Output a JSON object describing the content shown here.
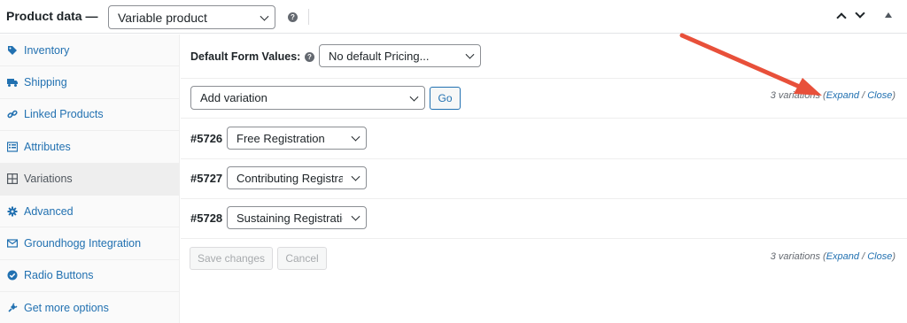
{
  "header": {
    "title": "Product data —",
    "product_type": "Variable product"
  },
  "sidebar": {
    "items": [
      {
        "label": "Inventory",
        "icon": "tag-icon"
      },
      {
        "label": "Shipping",
        "icon": "truck-icon"
      },
      {
        "label": "Linked Products",
        "icon": "link-icon"
      },
      {
        "label": "Attributes",
        "icon": "list-icon"
      },
      {
        "label": "Variations",
        "icon": "grid-icon"
      },
      {
        "label": "Advanced",
        "icon": "gear-icon"
      },
      {
        "label": "Groundhogg Integration",
        "icon": "email-icon"
      },
      {
        "label": "Radio Buttons",
        "icon": "check-circle-icon"
      },
      {
        "label": "Get more options",
        "icon": "plugin-icon"
      }
    ],
    "active_index": 4
  },
  "defaults": {
    "label": "Default Form Values:",
    "value": "No default Pricing..."
  },
  "toolbar": {
    "action": "Add variation",
    "go_label": "Go"
  },
  "meta": {
    "count": "3 variations (",
    "expand": "Expand",
    "sep": " / ",
    "close": "Close",
    "end": ")"
  },
  "variations": [
    {
      "id": "#5726",
      "value": "Free Registration"
    },
    {
      "id": "#5727",
      "value": "Contributing Registration"
    },
    {
      "id": "#5728",
      "value": "Sustaining Registration"
    }
  ],
  "footer": {
    "save_label": "Save changes",
    "cancel_label": "Cancel"
  },
  "colors": {
    "link": "#2271b1",
    "annotation_arrow": "#e8503a"
  }
}
